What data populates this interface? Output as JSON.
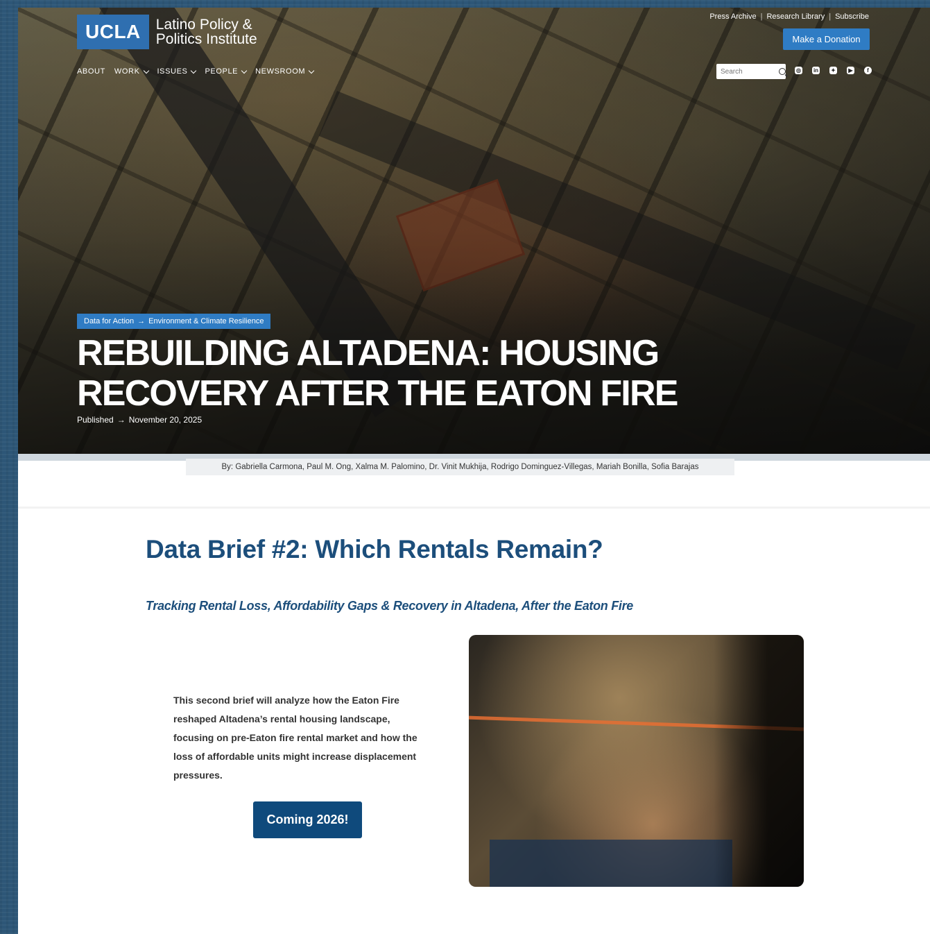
{
  "site": {
    "logo_mark": "UCLA",
    "logo_text": "Latino Policy & Politics Institute"
  },
  "utility_nav": {
    "items": [
      "Press Archive",
      "Research Library",
      "Subscribe"
    ],
    "donate_label": "Make a Donation"
  },
  "main_nav": {
    "items": [
      {
        "label": "ABOUT",
        "has_dropdown": false
      },
      {
        "label": "WORK",
        "has_dropdown": true
      },
      {
        "label": "ISSUES",
        "has_dropdown": true
      },
      {
        "label": "PEOPLE",
        "has_dropdown": true
      },
      {
        "label": "NEWSROOM",
        "has_dropdown": true
      }
    ]
  },
  "search": {
    "placeholder": "Search",
    "icon": "search-icon"
  },
  "social": {
    "icons": [
      "instagram-icon",
      "linkedin-icon",
      "twitter-icon",
      "youtube-icon",
      "facebook-icon"
    ]
  },
  "hero": {
    "breadcrumb_parent": "Data for Action",
    "breadcrumb_arrow": "→",
    "breadcrumb_child": "Environment & Climate Resilience",
    "title": "Rebuilding Altadena: Housing Recovery After the Eaton Fire",
    "published_label": "Published",
    "published_arrow": "→",
    "published_date": "November 20, 2025"
  },
  "authors": "By: Gabriella Carmona, Paul M. Ong, Xalma M. Palomino, Dr. Vinit Mukhija, Rodrigo Dominguez-Villegas, Mariah Bonilla, Sofia Barajas",
  "brief": {
    "title": "Data Brief #2: Which Rentals Remain?",
    "subtitle": "Tracking Rental Loss, Affordability Gaps & Recovery in Altadena, After the Eaton Fire",
    "body": "This second brief will analyze how the Eaton Fire reshaped Altadena’s rental housing landscape, focusing on pre-Eaton fire rental market and how the loss of affordable units might increase displacement pressures.",
    "cta_label": "Coming 2026!"
  },
  "colors": {
    "brand_blue": "#2f6fb0",
    "accent_blue": "#2f7cc4",
    "heading_blue": "#1c4e7b",
    "cta_blue": "#0f4a7c"
  }
}
